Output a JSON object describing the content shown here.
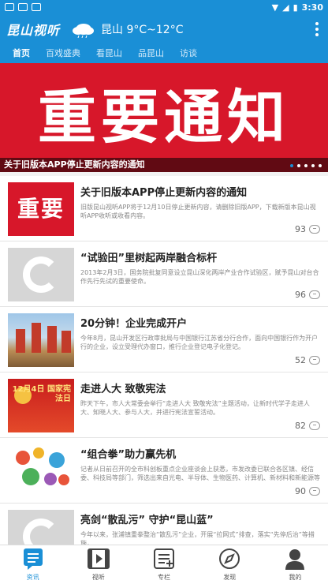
{
  "status_bar": {
    "time": "3:30",
    "icons": [
      "notification-icon",
      "notification-icon",
      "app-icon",
      "wifi-icon",
      "signal-icon",
      "battery-icon"
    ]
  },
  "header": {
    "logo": "昆山视听",
    "weather_icon": "cloud-icon",
    "weather": "昆山 9°C~12°C",
    "menu_icon": "more-vert-icon"
  },
  "tabs": [
    {
      "label": "首页",
      "active": true
    },
    {
      "label": "百戏盛典"
    },
    {
      "label": "看昆山"
    },
    {
      "label": "品昆山"
    },
    {
      "label": "访谈"
    }
  ],
  "banner": {
    "big_text": "重要通知",
    "caption": "关于旧版本APP停止更新内容的通知",
    "dots": 5,
    "active_dot": 0
  },
  "news": [
    {
      "title": "关于旧版本APP停止更新内容的通知",
      "summary": "旧版昆山视听APP将于12月10日停止更新内容，请删除旧版APP，下载新版本昆山视听APP收听或收看内容。",
      "count": "93",
      "thumb_text": "重要通知"
    },
    {
      "title": "“试验田”里树起两岸融合标杆",
      "summary": "2013年2月3日，国务院批复同意设立昆山深化两岸产业合作试验区，赋予昆山对台合作先行先试的重要使命。",
      "count": "96"
    },
    {
      "title": "20分钟！企业完成开户",
      "summary": "今年8月，昆山开发区行政审批局与中国银行江苏省分行合作，面向中国银行作为开户行的企业，设立受理代办窗口，推行企业登记电子化登记。",
      "count": "52"
    },
    {
      "title": "走进人大 致敬宪法",
      "summary": "昨天下午，市人大常委会举行“走进人大 致敬宪法”主题活动，让新时代学子走进人大、知晓人大、参与人大，并进行宪法宣誓活动。",
      "count": "82",
      "thumb_text": "12月4日 国家宪法日"
    },
    {
      "title": "“组合拳”助力赢先机",
      "summary": "记者从日前召开的全市科创板重点企业座谈会上获悉，市发改委已联合各区镇、经信委、科技局等部门，筛选出来自光电、半导体、生物医药、计算机、新材料和新能源等",
      "count": "90"
    },
    {
      "title": "亮剑“散乱污” 守护“昆山蓝”",
      "summary": "今年以来，张浦镇重拳整治“散乱污”企业，开展“拉网式”排查，落实“先停后治”等措施，",
      "count": ""
    }
  ],
  "bottom_nav": [
    {
      "label": "资讯",
      "icon": "news-icon",
      "active": true
    },
    {
      "label": "视听",
      "icon": "play-icon"
    },
    {
      "label": "专栏",
      "icon": "column-icon"
    },
    {
      "label": "发现",
      "icon": "compass-icon"
    },
    {
      "label": "我的",
      "icon": "user-icon"
    }
  ],
  "colors": {
    "primary": "#1a8fd6",
    "banner_red": "#d7172a"
  }
}
